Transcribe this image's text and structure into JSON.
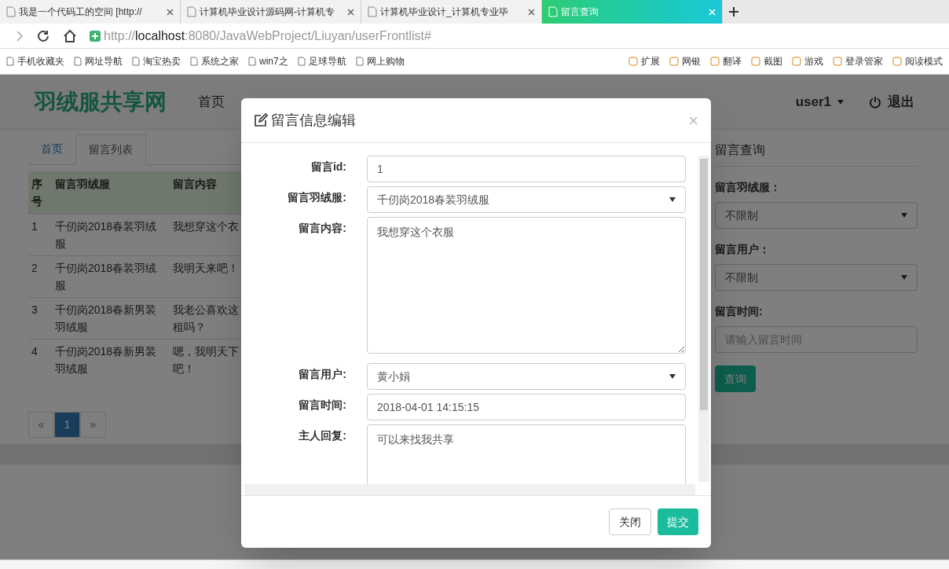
{
  "browser": {
    "tabs": [
      {
        "label": "我是一个代码工的空间 [http://",
        "selected": false
      },
      {
        "label": "计算机毕业设计源码网-计算机专",
        "selected": false
      },
      {
        "label": "计算机毕业设计_计算机专业毕",
        "selected": false
      },
      {
        "label": "留言查询",
        "selected": true
      }
    ],
    "url_host": "http://localhost",
    "url_rest": ":8080/JavaWebProject/Liuyan/userFrontlist#",
    "bookmarks": [
      "手机收藏夹",
      "网址导航",
      "淘宝热卖",
      "系统之家",
      "win7之",
      "足球导航",
      "网上购物"
    ],
    "extensions": [
      "扩展",
      "网银",
      "翻译",
      "截图",
      "游戏",
      "登录管家",
      "阅读模式"
    ]
  },
  "site": {
    "brand": "羽绒服共享网",
    "nav": [
      "首页"
    ],
    "user": "user1",
    "logout": "退出"
  },
  "breadcrumb": [
    {
      "label": "首页",
      "selected": false
    },
    {
      "label": "留言列表",
      "selected": true
    }
  ],
  "table": {
    "columns": [
      "序号",
      "留言羽绒服",
      "留言内容"
    ],
    "rows": [
      [
        "1",
        "千仞岗2018春装羽绒服",
        "我想穿这个衣"
      ],
      [
        "2",
        "千仞岗2018春装羽绒服",
        "我明天来吧！"
      ],
      [
        "3",
        "千仞岗2018春新男装羽绒服",
        "我老公喜欢这租吗？"
      ],
      [
        "4",
        "千仞岗2018春新男装羽绒服",
        "嗯，我明天下吧！"
      ]
    ]
  },
  "pagination": [
    {
      "label": "«",
      "selected": false
    },
    {
      "label": "1",
      "selected": true
    },
    {
      "label": "»",
      "selected": false
    }
  ],
  "query": {
    "title": "留言查询",
    "fields": [
      {
        "label": "留言羽绒服：",
        "kind": "select",
        "value": "不限制"
      },
      {
        "label": "留言用户：",
        "kind": "select",
        "value": "不限制"
      },
      {
        "label": "留言时间:",
        "kind": "input",
        "placeholder": "请输入留言时间"
      }
    ],
    "button": "查询"
  },
  "modal": {
    "title": "留言信息编辑",
    "close": "×",
    "fields": [
      {
        "label": "留言id:",
        "kind": "readonly",
        "value": "1"
      },
      {
        "label": "留言羽绒服:",
        "kind": "select",
        "value": "千仞岗2018春装羽绒服"
      },
      {
        "label": "留言内容:",
        "kind": "textarea",
        "value": "我想穿这个衣服"
      },
      {
        "label": "留言用户:",
        "kind": "select",
        "value": "黄小娟"
      },
      {
        "label": "留言时间:",
        "kind": "input",
        "value": "2018-04-01 14:15:15"
      },
      {
        "label": "主人回复:",
        "kind": "textarea_short",
        "value": "可以来找我共享"
      }
    ],
    "buttons": [
      {
        "label": "关闭",
        "kind": "default"
      },
      {
        "label": "提交",
        "kind": "primary"
      }
    ]
  }
}
